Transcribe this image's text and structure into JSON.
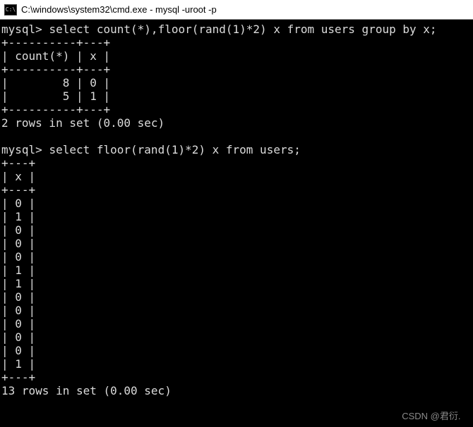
{
  "window": {
    "icon_label": "C:\\",
    "title": "C:\\windows\\system32\\cmd.exe - mysql  -uroot -p"
  },
  "terminal": {
    "prompt": "mysql>",
    "query1": {
      "text": "select count(*),floor(rand(1)*2) x from users group by x;",
      "border_top": "+----------+---+",
      "header_line": "| count(*) | x |",
      "border_mid": "+----------+---+",
      "rows": [
        {
          "count": 8,
          "x": 0,
          "line": "|        8 | 0 |"
        },
        {
          "count": 5,
          "x": 1,
          "line": "|        5 | 1 |"
        }
      ],
      "border_bot": "+----------+---+",
      "status": "2 rows in set (0.00 sec)"
    },
    "query2": {
      "text": "select floor(rand(1)*2) x from users;",
      "border_top": "+---+",
      "header_line": "| x |",
      "border_mid": "+---+",
      "values": [
        0,
        1,
        0,
        0,
        0,
        1,
        1,
        0,
        0,
        0,
        0,
        0,
        1
      ],
      "border_bot": "+---+",
      "status": "13 rows in set (0.00 sec)"
    }
  },
  "watermark": {
    "text": "CSDN @君衍.⠀"
  }
}
